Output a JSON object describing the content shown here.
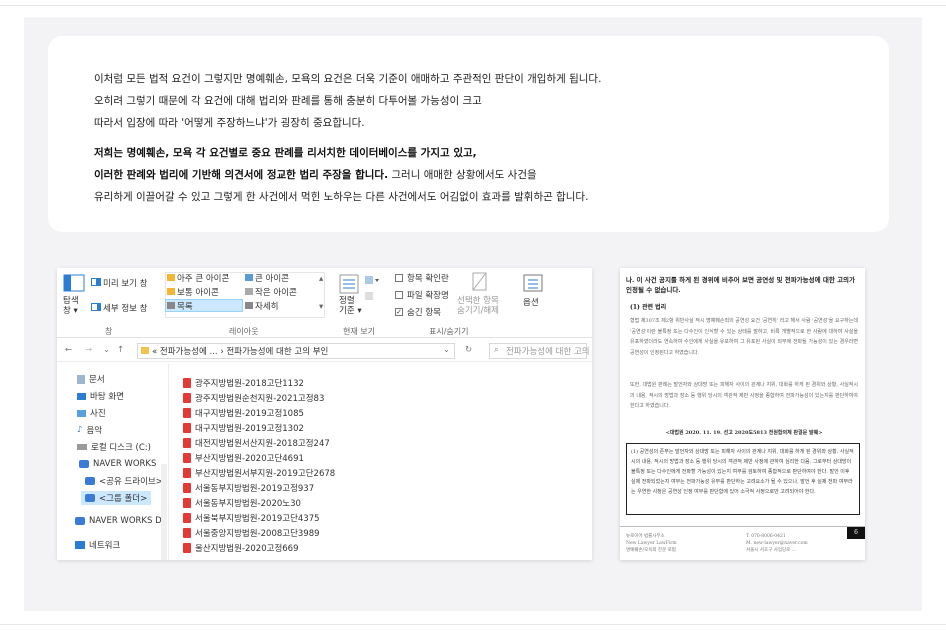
{
  "intro": {
    "line1": "이처럼 모든 법적 요건이 그렇지만 명예훼손, 모욕의 요건은 더욱 기준이 애매하고 주관적인 판단이 개입하게 됩니다.",
    "line2": "오히려 그렇기 때문에 각 요건에 대해 법리와 판례를 통해 충분히 다투어볼 가능성이 크고",
    "line3": "따라서 입장에 따라 '어떻게 주장하느냐'가 굉장히 중요합니다."
  },
  "body": {
    "bold1": "저희는 명예훼손, 모욕 각 요건별로 중요 판례를 리서치한 데이터베이스를 가지고 있고,",
    "bold2": "이러한 판례와 법리에 기반해 의견서에 정교한 법리 주장을 합니다.",
    "normal2": " 그러니 애매한 상황에서도 사건을",
    "line3": "유리하게 이끌어갈 수 있고 그렇게 한 사건에서 먹힌 노하우는 다른 사건에서도 어김없이 효과를 발휘하곤 합니다."
  },
  "explorer": {
    "ribbon": {
      "nav_pane": "탐색\n창 ▾",
      "preview_pane": "미리 보기 창",
      "details_pane": "세부 정보 창",
      "group_pane": "창",
      "layout_xl": "아주 큰 아이콘",
      "layout_l": "큰 아이콘",
      "layout_m": "보통 아이콘",
      "layout_s": "작은 아이콘",
      "layout_list": "목록",
      "layout_detail": "자세히",
      "group_layout": "레이아웃",
      "sort": "정렬\n기준 ▾",
      "group_view": "현재 보기",
      "chk_ext": "항목 확인란",
      "chk_fileext": "파일 확장명",
      "chk_hidden": "숨긴 항목",
      "hide_selected": "선택한 항목\n숨기기/해제",
      "group_showhide": "표시/숨기기",
      "options": "옵션"
    },
    "address": "« 전파가능성에 ... › 전파가능성에 대한 고의 부인",
    "search_placeholder": "전파가능성에 대한 고의 부...",
    "nav": [
      "문서",
      "바탕 화면",
      "사진",
      "음악",
      "로컬 디스크 (C:)",
      "NAVER WORKS",
      "<공유 드라이브>",
      "<그룹 폴더>",
      "NAVER WORKS D",
      "네트워크"
    ],
    "files": [
      "광주지방법원-2018고단1132",
      "광주지방법원순천지원-2021고정83",
      "대구지방법원-2019고정1085",
      "대구지방법원-2019고정1302",
      "대전지방법원서산지원-2018고정247",
      "부산지방법원-2020고단4691",
      "부산지방법원서부지원-2019고단2678",
      "서울동부지방법원-2019고정937",
      "서울동부지방법원-2020노30",
      "서울북부지방법원-2019고단4375",
      "서울중앙지방법원-2008고단3989",
      "울산지방법원-2020고정669"
    ]
  },
  "doc": {
    "heading": "나. 이 사건 공지를 하게 된 경위에 비추어 보면 공연성 및 전파가능성에 대한 고의가 인정될 수 없습니다.",
    "subheading": "(1) 관련 법리",
    "para1": "형법 제307조 제2항 위반사실 적시 명예훼손죄의 공연성 요건 '공연히' 라고 해서 사람 '공연성'을 요구하는데 '공연성'이란 불특정 또는 다수인이 인식할 수 있는 상태를 말하고, 비록 개별적으로 한 사람에 대하여 사실을 유포하였더라도 연속하여 수인에게 사실을 유포하여 그 유포된 사실이 외부에 전파될 가능성이 있는 경우라면 공연성이 인정된다고 하였습니다.",
    "para2": "또한, 대법원 판례는 발언자와 상대방 또는 피해자 사이의 관계나 지위, 대화를 하게 된 경위와 상황, 사실적시의 내용, 적시의 방법과 장소 등 행위 당시의 객관적 제반 사정을 종합하여 전파가능성이 있는지를 판단하여야 한다고 하였습니다.",
    "citation": "<대법원 2020. 11. 19. 선고 2020도5813 전원합의체 판결문 발췌>",
    "box_text": "(1) 공연성의 존부는 발언자와 상대방 또는 피해자 사이의 관계나 지위, 대화를 하게 된 경위와 상황, 사실적시의 내용, 적시의 방법과 장소 등 행위 당시의 객관적 제반 사정에 관하여 심리한 다음, 그로부터 상대방이 불특정 또는 다수인에게 전파할 가능성이 있는지 여부를 검토하여 종합적으로 판단하여야 한다. 발언 이후 실제 전파되었는지 여부는 전파가능성 유무를 판단하는 고려요소가 될 수 있으나, 발언 후 실제 전파 여부라는 우연한 사정은 공연성 인정 여부를 판단함에 있어 소극적 사정으로만 고려되어야 한다.",
    "page_no": "6",
    "footer_left": "뉴로이어 법률사무소\nNew Lawyer LawFirm\n명예훼손/모욕죄 전문 로펌",
    "footer_mid": "T. 070-8006-0421\nM. new-lawyer@naver.com\n서울시 서초구 사임당로 ..."
  }
}
